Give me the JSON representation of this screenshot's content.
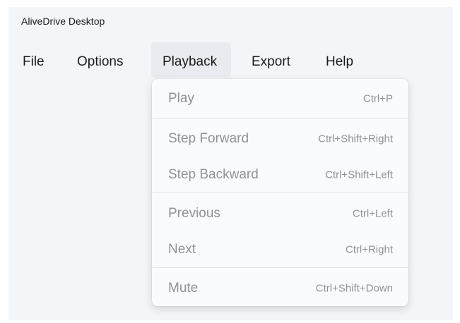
{
  "window": {
    "title": "AliveDrive Desktop"
  },
  "menubar": {
    "items": [
      {
        "label": "File"
      },
      {
        "label": "Options"
      },
      {
        "label": "Playback"
      },
      {
        "label": "Export"
      },
      {
        "label": "Help"
      }
    ],
    "active": "Playback"
  },
  "playback_menu": {
    "items": [
      {
        "label": "Play",
        "shortcut": "Ctrl+P",
        "enabled": false
      },
      {
        "label": "Step Forward",
        "shortcut": "Ctrl+Shift+Right",
        "enabled": false
      },
      {
        "label": "Step Backward",
        "shortcut": "Ctrl+Shift+Left",
        "enabled": false
      },
      {
        "label": "Previous",
        "shortcut": "Ctrl+Left",
        "enabled": false
      },
      {
        "label": "Next",
        "shortcut": "Ctrl+Right",
        "enabled": false
      },
      {
        "label": "Mute",
        "shortcut": "Ctrl+Shift+Down",
        "enabled": false
      }
    ]
  },
  "colors": {
    "window_bg": "#f3f6f9",
    "menu_bg": "#f9fbfd",
    "disabled_text": "#8f9296",
    "active_menu_bg": "#e8ecf0"
  }
}
